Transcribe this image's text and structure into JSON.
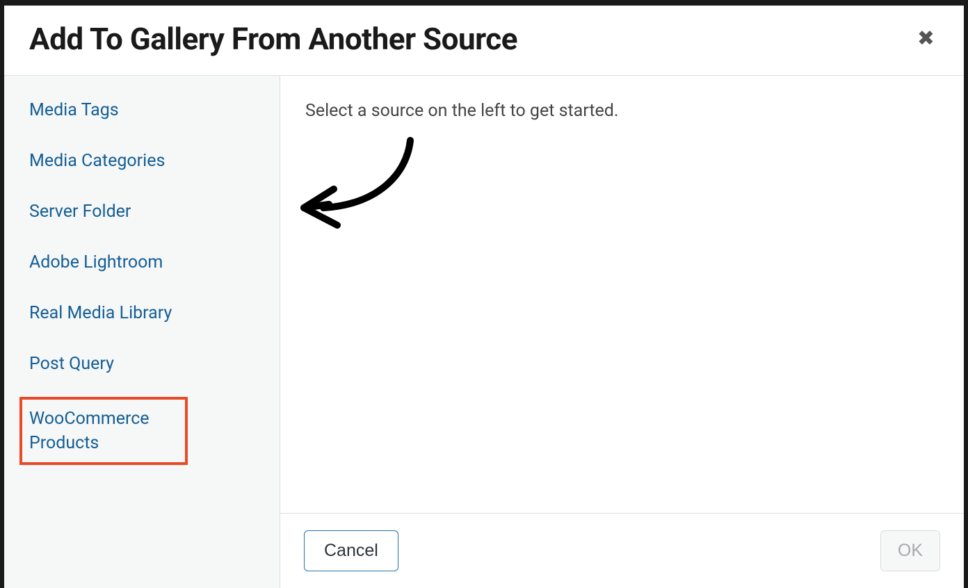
{
  "modal": {
    "title": "Add To Gallery From Another Source"
  },
  "sidebar": {
    "items": [
      {
        "label": "Media Tags",
        "highlighted": false
      },
      {
        "label": "Media Categories",
        "highlighted": false
      },
      {
        "label": "Server Folder",
        "highlighted": false
      },
      {
        "label": "Adobe Lightroom",
        "highlighted": false
      },
      {
        "label": "Real Media Library",
        "highlighted": false
      },
      {
        "label": "Post Query",
        "highlighted": false
      },
      {
        "label": "WooCommerce Products",
        "highlighted": true
      }
    ]
  },
  "main": {
    "instruction": "Select a source on the left to get started."
  },
  "footer": {
    "cancel_label": "Cancel",
    "ok_label": "OK"
  }
}
